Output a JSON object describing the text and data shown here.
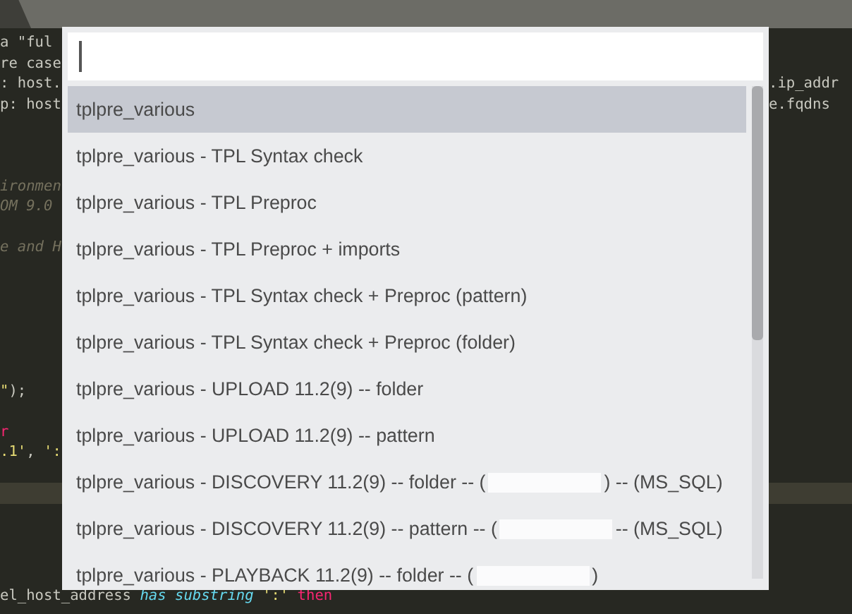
{
  "editor": {
    "lines": [
      {
        "kind": "code",
        "left": [
          {
            "text": "a \"ful",
            "kind": "plain"
          }
        ]
      },
      {
        "kind": "code",
        "left": [
          {
            "text": "re case",
            "kind": "plain"
          }
        ]
      },
      {
        "kind": "code",
        "left": [
          {
            "text": ": host.",
            "kind": "plain"
          }
        ],
        "right": [
          {
            "text": ".ip_addr",
            "kind": "plain"
          }
        ]
      },
      {
        "kind": "code",
        "left": [
          {
            "text": "p: host",
            "kind": "plain"
          }
        ],
        "right": [
          {
            "text": "e.fqdns",
            "kind": "plain"
          }
        ]
      },
      {
        "kind": "blank"
      },
      {
        "kind": "blank"
      },
      {
        "kind": "blank"
      },
      {
        "kind": "code",
        "left": [
          {
            "text": "ironmen",
            "kind": "comment"
          }
        ]
      },
      {
        "kind": "code",
        "left": [
          {
            "text": "OM 9.0",
            "kind": "comment"
          }
        ]
      },
      {
        "kind": "blank"
      },
      {
        "kind": "code",
        "left": [
          {
            "text": "e and H",
            "kind": "comment"
          }
        ]
      },
      {
        "kind": "blank"
      },
      {
        "kind": "blank"
      },
      {
        "kind": "blank"
      },
      {
        "kind": "blank"
      },
      {
        "kind": "blank"
      },
      {
        "kind": "blank"
      },
      {
        "kind": "code",
        "left": [
          {
            "text": "\"",
            "kind": "string"
          },
          {
            "text": ");",
            "kind": "plain"
          }
        ]
      },
      {
        "kind": "blank"
      },
      {
        "kind": "code",
        "left": [
          {
            "text": "r",
            "kind": "keyword"
          }
        ]
      },
      {
        "kind": "code",
        "left": [
          {
            "text": ".1'",
            "kind": "string"
          },
          {
            "text": ", ",
            "kind": "plain"
          },
          {
            "text": "':",
            "kind": "string"
          }
        ]
      },
      {
        "kind": "blank"
      },
      {
        "kind": "current"
      },
      {
        "kind": "blank"
      },
      {
        "kind": "blank"
      },
      {
        "kind": "blank"
      },
      {
        "kind": "blank"
      },
      {
        "kind": "code",
        "left": [
          {
            "text": "el_host_address ",
            "kind": "plain"
          },
          {
            "text": "has substring",
            "kind": "operator"
          },
          {
            "text": " ':'",
            "kind": "string"
          },
          {
            "text": " then",
            "kind": "keyword"
          }
        ]
      }
    ]
  },
  "palette": {
    "items": [
      {
        "label": "tplpre_various",
        "selected": true
      },
      {
        "label": "tplpre_various - TPL Syntax check",
        "selected": false
      },
      {
        "label": "tplpre_various - TPL Preproc",
        "selected": false
      },
      {
        "label": "tplpre_various - TPL Preproc + imports",
        "selected": false
      },
      {
        "label": "tplpre_various - TPL Syntax check + Preproc (pattern)",
        "selected": false
      },
      {
        "label": "tplpre_various - TPL Syntax check + Preproc (folder)",
        "selected": false
      },
      {
        "label": "tplpre_various - UPLOAD 11.2(9) -- folder",
        "selected": false
      },
      {
        "label": "tplpre_various - UPLOAD 11.2(9) -- pattern",
        "selected": false
      },
      {
        "label": "tplpre_various - DISCOVERY 11.2(9) -- folder -- (",
        "after_redaction": ") -- (MS_SQL)",
        "selected": false
      },
      {
        "label": "tplpre_various - DISCOVERY 11.2(9) -- pattern -- (",
        "after_redaction": "-- (MS_SQL)",
        "selected": false
      },
      {
        "label": "tplpre_various - PLAYBACK 11.2(9) -- folder -- (",
        "after_redaction": ")",
        "selected": false
      }
    ]
  }
}
